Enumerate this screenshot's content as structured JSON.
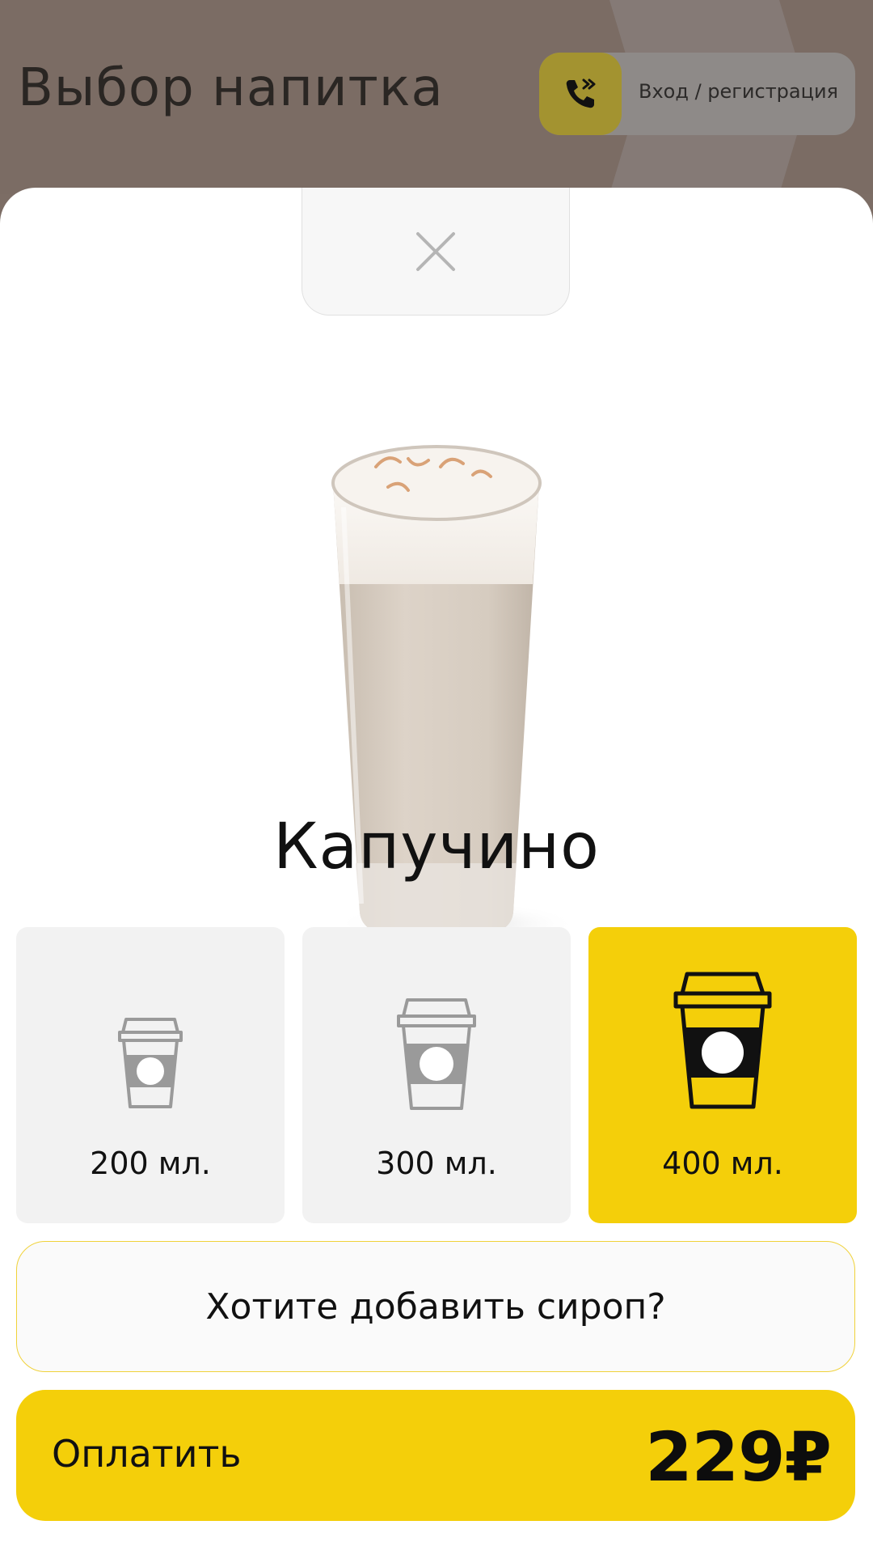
{
  "header": {
    "title": "Выбор напитка",
    "login_label": "Вход / регистрация",
    "phone_icon": "phone-in-icon"
  },
  "modal": {
    "close_icon": "close-icon",
    "drink_name": "Капучино",
    "sizes": [
      {
        "label": "200 мл.",
        "selected": false
      },
      {
        "label": "300 мл.",
        "selected": false
      },
      {
        "label": "400 мл.",
        "selected": true
      }
    ],
    "syrup_label": "Хотите добавить сироп?",
    "pay_label": "Оплатить",
    "price": "229₽"
  },
  "colors": {
    "accent": "#F4CF0A",
    "header_bg": "#7B6C64",
    "card_bg": "#F2F2F2",
    "cup_gray": "#9A9A9A"
  }
}
